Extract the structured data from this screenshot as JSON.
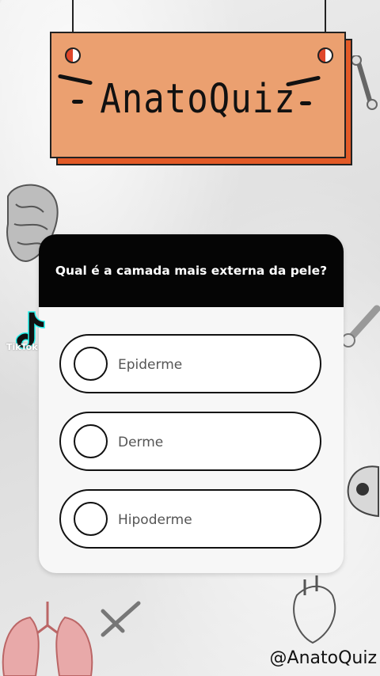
{
  "sign": {
    "title": "AnatoQuiz"
  },
  "quiz": {
    "question": "Qual é a camada mais externa da pele?",
    "options": [
      {
        "label": "Epiderme"
      },
      {
        "label": "Derme"
      },
      {
        "label": "Hipoderme"
      }
    ]
  },
  "overlay": {
    "platform": "TikTok",
    "handle": "@AnatoQuiz"
  },
  "colors": {
    "sign_face": "#eba070",
    "sign_shadow": "#e25a27",
    "header": "#050505"
  }
}
